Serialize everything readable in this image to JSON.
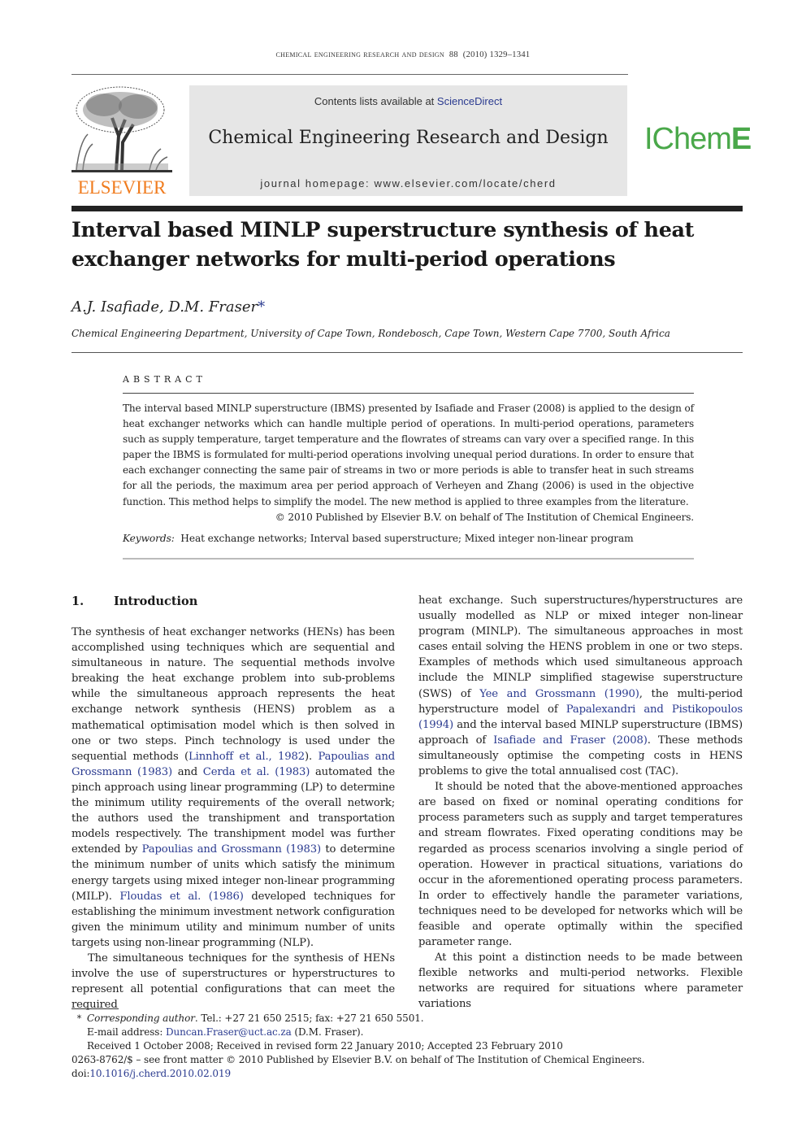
{
  "running_head": {
    "journal": "chemical engineering research and design",
    "volume": "88",
    "year": "(2010)",
    "pages": "1329–1341"
  },
  "publisher_logo": {
    "wordmark": "ELSEVIER",
    "color": "#f07c1f"
  },
  "banner": {
    "contents_prefix": "Contents lists available at ",
    "contents_link": "ScienceDirect",
    "journal_title": "Chemical Engineering Research and Design",
    "homepage": "journal homepage: www.elsevier.com/locate/cherd"
  },
  "society_logo": {
    "text_light": "IChem",
    "text_bold": "E",
    "color": "#4aa84a"
  },
  "article": {
    "title": "Interval based MINLP superstructure synthesis of heat exchanger networks for multi-period operations",
    "authors": "A.J. Isafiade, D.M. Fraser",
    "author_marker": "*",
    "affiliation": "Chemical Engineering Department, University of Cape Town, Rondebosch, Cape Town, Western Cape 7700, South Africa"
  },
  "abstract": {
    "heading": "ABSTRACT",
    "body": "The interval based MINLP superstructure (IBMS) presented by Isafiade and Fraser (2008) is applied to the design of heat exchanger networks which can handle multiple period of operations. In multi-period operations, parameters such as supply temperature, target temperature and the flowrates of streams can vary over a specified range. In this paper the IBMS is formulated for multi-period operations involving unequal period durations. In order to ensure that each exchanger connecting the same pair of streams in two or more periods is able to transfer heat in such streams for all the periods, the maximum area per period approach of Verheyen and Zhang (2006) is used in the objective function. This method helps to simplify the model. The new method is applied to three examples from the literature.",
    "copyright": "© 2010 Published by Elsevier B.V. on behalf of The Institution of Chemical Engineers.",
    "keywords_label": "Keywords:",
    "keywords": "Heat exchange networks; Interval based superstructure; Mixed integer non-linear program"
  },
  "section1": {
    "number": "1.",
    "heading": "Introduction",
    "left_p1": [
      {
        "t": "The synthesis of heat exchanger networks (HENs) has been accomplished using techniques which are sequential and simultaneous in nature. The sequential methods involve breaking the heat exchange problem into sub-problems while the simultaneous approach represents the heat exchange network synthesis (HENS) problem as a mathematical optimisation model which is then solved in one or two steps. Pinch technology is used under the sequential methods ("
      },
      {
        "link": "Linnhoff et al., 1982"
      },
      {
        "t": "). "
      },
      {
        "link": "Papoulias and Grossmann (1983)"
      },
      {
        "t": " and "
      },
      {
        "link": "Cerda et al. (1983)"
      },
      {
        "t": " automated the pinch approach using linear programming (LP) to determine the minimum utility requirements of the overall network; the authors used the transhipment and transportation models respectively. The transhipment model was further extended by "
      },
      {
        "link": "Papoulias and Grossmann (1983)"
      },
      {
        "t": " to determine the minimum number of units which satisfy the minimum energy targets using mixed integer non-linear programming (MILP). "
      },
      {
        "link": "Floudas et al. (1986)"
      },
      {
        "t": " developed techniques for establishing the minimum investment network configuration given the minimum utility and minimum number of units targets using non-linear programming (NLP)."
      }
    ],
    "left_p2": "The simultaneous techniques for the synthesis of HENs involve the use of superstructures or hyperstructures to represent all potential configurations that can meet the required",
    "right_p1": [
      {
        "t": "heat exchange. Such superstructures/hyperstructures are usually modelled as NLP or mixed integer non-linear program (MINLP). The simultaneous approaches in most cases entail solving the HENS problem in one or two steps. Examples of methods which used simultaneous approach include the MINLP simplified stagewise superstructure (SWS) of "
      },
      {
        "link": "Yee and Grossmann (1990)"
      },
      {
        "t": ", the multi-period hyperstructure model of "
      },
      {
        "link": "Papalexandri and Pistikopoulos (1994)"
      },
      {
        "t": " and the interval based MINLP superstructure (IBMS) approach of "
      },
      {
        "link": "Isafiade and Fraser (2008)"
      },
      {
        "t": ". These methods simultaneously optimise the competing costs in HENS problems to give the total annualised cost (TAC)."
      }
    ],
    "right_p2": "It should be noted that the above-mentioned approaches are based on fixed or nominal operating conditions for process parameters such as supply and target temperatures and stream flowrates. Fixed operating conditions may be regarded as process scenarios involving a single period of operation. However in practical situations, variations do occur in the aforementioned operating process parameters. In order to effectively handle the parameter variations, techniques need to be developed for networks which will be feasible and operate optimally within the specified parameter range.",
    "right_p3": "At this point a distinction needs to be made between flexible networks and multi-period networks. Flexible networks are required for situations where parameter variations"
  },
  "footnotes": {
    "marker": "*",
    "corr_label": "Corresponding author",
    "corr_rest": ". Tel.: +27 21 650 2515; fax: +27 21 650 5501.",
    "email_prefix": "E-mail address: ",
    "email": "Duncan.Fraser@uct.ac.za",
    "email_suffix": " (D.M. Fraser).",
    "received": "Received 1 October 2008; Received in revised form 22 January 2010; Accepted 23 February 2010",
    "front_matter": "0263-8762/$ – see front matter © 2010 Published by Elsevier B.V. on behalf of The Institution of Chemical Engineers.",
    "doi_prefix": "doi:",
    "doi": "10.1016/j.cherd.2010.02.019"
  }
}
